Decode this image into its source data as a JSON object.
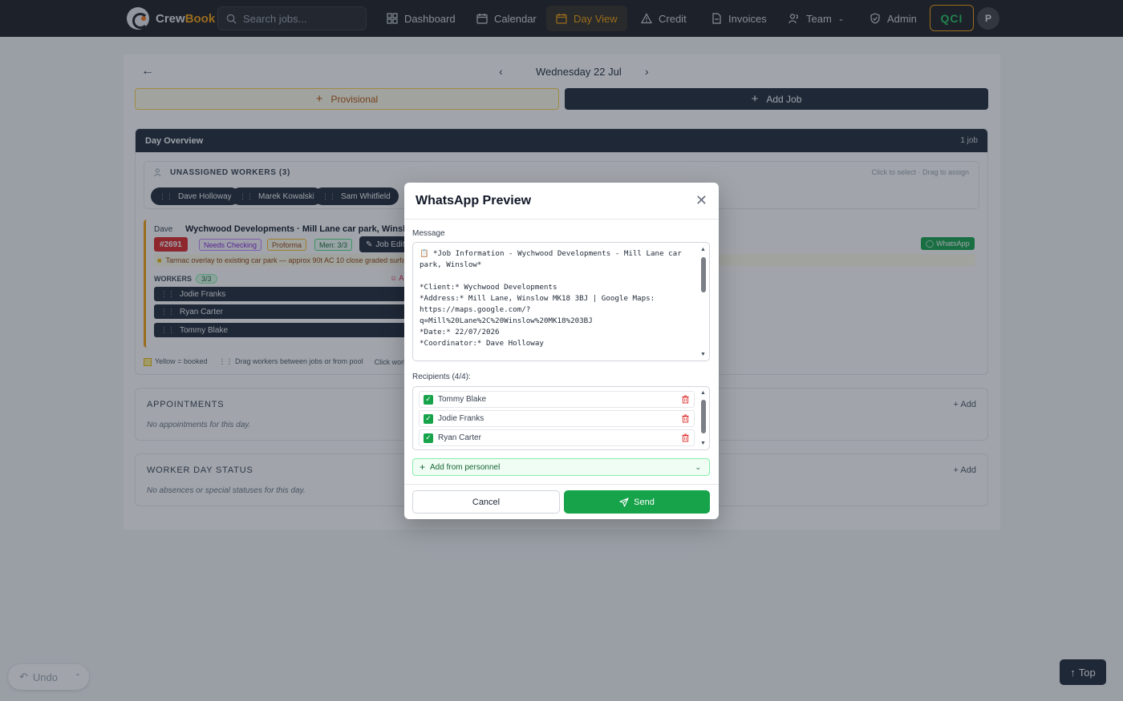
{
  "nav": {
    "brand_part1": "Crew",
    "brand_part2": "Book",
    "search_placeholder": "Search jobs...",
    "items": [
      {
        "label": "Dashboard",
        "icon": "grid-icon"
      },
      {
        "label": "Calendar",
        "icon": "calendar-icon"
      },
      {
        "label": "Day View",
        "icon": "calendar-day-icon",
        "active": true
      },
      {
        "label": "Credit",
        "icon": "warning-icon"
      },
      {
        "label": "Invoices",
        "icon": "invoice-icon"
      },
      {
        "label": "Team",
        "icon": "users-icon"
      },
      {
        "label": "Admin",
        "icon": "shield-icon"
      }
    ],
    "qci_label": "QCI",
    "avatar_initial": "P"
  },
  "day": {
    "date": "Wednesday 22 Jul",
    "provisional_label": "Provisional",
    "add_job_label": "Add Job"
  },
  "overview": {
    "title": "Day Overview",
    "count": "1 job",
    "unassigned_title": "UNASSIGNED WORKERS (3)",
    "unassigned_hint": "Click to select · Drag to assign",
    "unassigned_workers": [
      "Dave Holloway",
      "Marek Kowalski",
      "Sam Whitfield"
    ]
  },
  "job": {
    "coordinator": "Dave",
    "title": "Wychwood Developments · Mill Lane car park, Winslow",
    "number": "#2691",
    "status": "Needs Checking",
    "invoice_type": "Proforma",
    "men": "Men: 3/3",
    "edit_label": "Job Edit",
    "whatsapp_label": "WhatsApp",
    "note": "Tarmac overlay to existing car park — approx 90t AC 10 close graded surfac",
    "workers_label": "WORKERS",
    "workers_count": "3/3",
    "assign_label": "A",
    "workers": [
      "Jodie Franks",
      "Ryan Carter",
      "Tommy Blake"
    ],
    "worker_tag": "D"
  },
  "legend": {
    "booked": "Yellow = booked",
    "drag": "Drag workers between jobs or from pool",
    "click": "Click worker n"
  },
  "appointments": {
    "title": "APPOINTMENTS",
    "empty": "No appointments for this day.",
    "add_label": "Add"
  },
  "worker_status": {
    "title": "WORKER DAY STATUS",
    "empty": "No absences or special statuses for this day.",
    "add_label": "Add"
  },
  "modal": {
    "title": "WhatsApp Preview",
    "message_label": "Message",
    "message_text": "📋 *Job Information - Wychwood Developments - Mill Lane car park, Winslow*\n\n*Client:* Wychwood Developments\n*Address:* Mill Lane, Winslow MK18 3BJ | Google Maps: https://maps.google.com/?q=Mill%20Lane%2C%20Winslow%20MK18%203BJ\n*Date:* 22/07/2026\n*Coordinator:* Dave Holloway",
    "recipients_label": "Recipients (4/4):",
    "recipients": [
      "Tommy Blake",
      "Jodie Franks",
      "Ryan Carter"
    ],
    "add_personnel_label": "Add from personnel",
    "cancel_label": "Cancel",
    "send_label": "Send"
  },
  "floating": {
    "undo_label": "Undo",
    "top_label": "Top"
  },
  "colors": {
    "nav_bg": "#1c1d21",
    "accent": "#f59e0b",
    "success": "#16a34a",
    "danger": "#dc2626"
  }
}
